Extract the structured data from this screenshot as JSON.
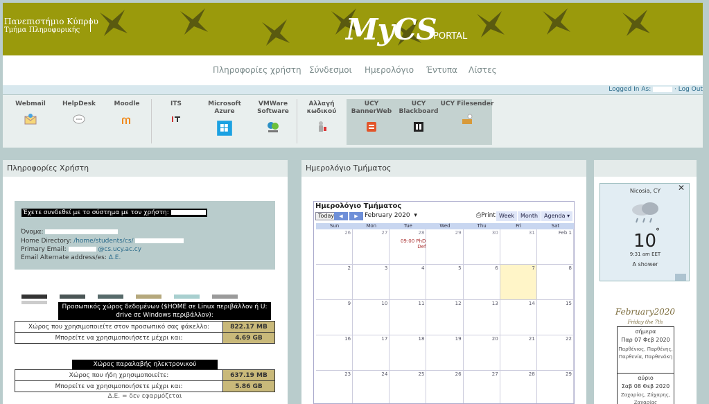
{
  "header": {
    "university_line1": "Πανεπιστήμιο Κύπρου",
    "university_line2": "Τμήμα Πληροφορικής",
    "logo": "MyCS",
    "logo_suffix": "PORTAL"
  },
  "nav": {
    "items": [
      "Πληροφορίες χρήστη",
      "Σύνδεσμοι",
      "Ημερολόγιο",
      "Έντυπα",
      "Λίστες"
    ]
  },
  "login": {
    "prefix": "Logged In As:",
    "separator": "·",
    "logout": "Log Out"
  },
  "toolbar": {
    "items": [
      {
        "label": "Webmail",
        "icon": "mail-icon"
      },
      {
        "label": "HelpDesk",
        "icon": "chat-bubble-icon"
      },
      {
        "label": "Moodle",
        "icon": "moodle-icon"
      },
      {
        "label": "ITS",
        "icon": "its-icon"
      },
      {
        "label": "Microsoft Azure",
        "icon": "azure-icon"
      },
      {
        "label": "VMWare Software",
        "icon": "vmware-icon"
      },
      {
        "label": "Αλλαγή κωδικού",
        "icon": "password-change-icon"
      },
      {
        "label": "UCY BannerWeb",
        "icon": "bannerweb-icon"
      },
      {
        "label": "UCY Blackboard",
        "icon": "blackboard-icon"
      },
      {
        "label": "UCY Filesender",
        "icon": "filesender-icon"
      }
    ]
  },
  "user_panel": {
    "title": "Πληροφορίες Χρήστη",
    "connected_text": "Έχετε συνδεθεί με το σύστημα με τον χρήστη:",
    "name_label": "Όνομα:",
    "home_label": "Home Directory:",
    "home_value": "/home/students/cs/",
    "email_label": "Primary Email:",
    "email_value": "@cs.ucy.ac.cy",
    "alt_label": "Email Alternate address/es:",
    "alt_value": "Δ.Ε.",
    "home_quota_header": "Προσωπικός χώρος δεδομένων ($HOME σε Linux περιβάλλον ή U: drive σε Windows περιβάλλον):",
    "home_used_label": "Χώρος που χρησιμοποιείτε στον προσωπικό σας φάκελλο:",
    "home_used_value": "822.17 MB",
    "home_limit_label": "Μπορείτε να χρησιμοποιήσετε μέχρι και:",
    "home_limit_value": "4.69 GB",
    "mail_quota_header": "Χώρος παραλαβής ηλεκτρονικού ταχυδρομείου:",
    "mail_used_label": "Χώρος που ήδη χρησιμοποιείτε:",
    "mail_used_value": "637.19 MB",
    "mail_limit_label": "Μπορείτε να χρησιμοποιήσετε μέχρι και:",
    "mail_limit_value": "5.86 GB",
    "note": "Δ.Ε. = δεν εφαρμόζεται"
  },
  "calendar_panel": {
    "title": "Ημερολόγιο Τμήματος",
    "widget_title": "Ημερολόγιο Τμήματος",
    "today_btn": "Today",
    "month": "February 2020",
    "print": "Print",
    "view_week": "Week",
    "view_month": "Month",
    "view_agenda": "Agenda",
    "weekdays": [
      "Sun",
      "Mon",
      "Tue",
      "Wed",
      "Thu",
      "Fri",
      "Sat"
    ],
    "weeks": [
      [
        "26",
        "27",
        "28",
        "29",
        "30",
        "31",
        "Feb 1"
      ],
      [
        "2",
        "3",
        "4",
        "5",
        "6",
        "7",
        "8"
      ],
      [
        "9",
        "10",
        "11",
        "12",
        "13",
        "14",
        "15"
      ],
      [
        "16",
        "17",
        "18",
        "19",
        "20",
        "21",
        "22"
      ],
      [
        "23",
        "24",
        "25",
        "26",
        "27",
        "28",
        "29"
      ]
    ],
    "event": "09:00 PhD Def"
  },
  "weather": {
    "city": "Nicosia, CY",
    "close": "✕",
    "temp": "10",
    "deg": "°",
    "time": "9:31 am EET",
    "condition": "A shower"
  },
  "mini_calendar": {
    "title": "February2020",
    "subtitle": "Friday the 7th",
    "today_label": "σήμερα",
    "today_date": "Παρ 07 Φεβ 2020",
    "today_names": "Παρθένιος, Παρθένης, Παρθενία, Παρθενάκη",
    "tomorrow_label": "αύριο",
    "tomorrow_date": "Σαβ 08 Φεβ 2020",
    "tomorrow_names": "Ζαχαρίας, Ζάχαρης, Ζαχαρίας"
  }
}
